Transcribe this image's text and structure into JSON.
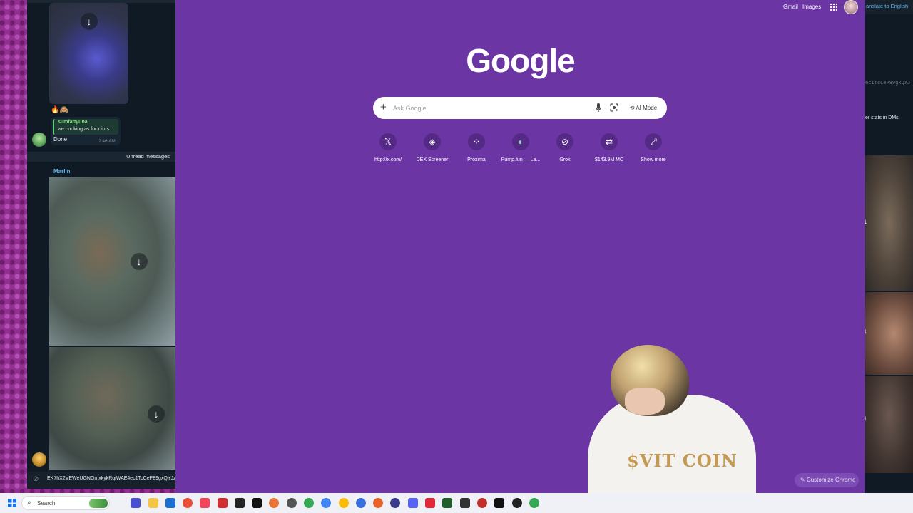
{
  "chat": {
    "reply_name": "sumfattyuna",
    "reply_text": "we cooking as fuck in s...",
    "message_text": "Done",
    "message_time": "2:46 AM",
    "unread_label": "Unread messages",
    "sender_name": "Marlin",
    "composer_text": "EK7hX2VEWeUGNGmxkykRqiWAE4ec1TcCeP89gxQYJz"
  },
  "chrome": {
    "gmail": "Gmail",
    "images": "Images",
    "logo": "Google",
    "search_placeholder": "Ask Google",
    "ai_mode": "AI Mode",
    "customize": "Customize Chrome",
    "shortcuts": [
      {
        "label": "http://x.com/",
        "icon": "x-logo-icon"
      },
      {
        "label": "DEX Screener",
        "icon": "dex-screener-icon"
      },
      {
        "label": "Proxima",
        "icon": "proxima-icon"
      },
      {
        "label": "Pump.fun — La...",
        "icon": "pill-icon"
      },
      {
        "label": "Grok",
        "icon": "grok-icon"
      },
      {
        "label": "$143.9M MC",
        "icon": "dex-icon"
      },
      {
        "label": "Show more",
        "icon": "expand-icon"
      }
    ]
  },
  "right_window": {
    "translate": "anslate to English",
    "hash": "ec1TcCeP89gxQYJ",
    "stats": "er stats in DMs"
  },
  "overlay": {
    "shirt_text": "$VIT COIN"
  },
  "taskbar": {
    "search_label": "Search"
  }
}
